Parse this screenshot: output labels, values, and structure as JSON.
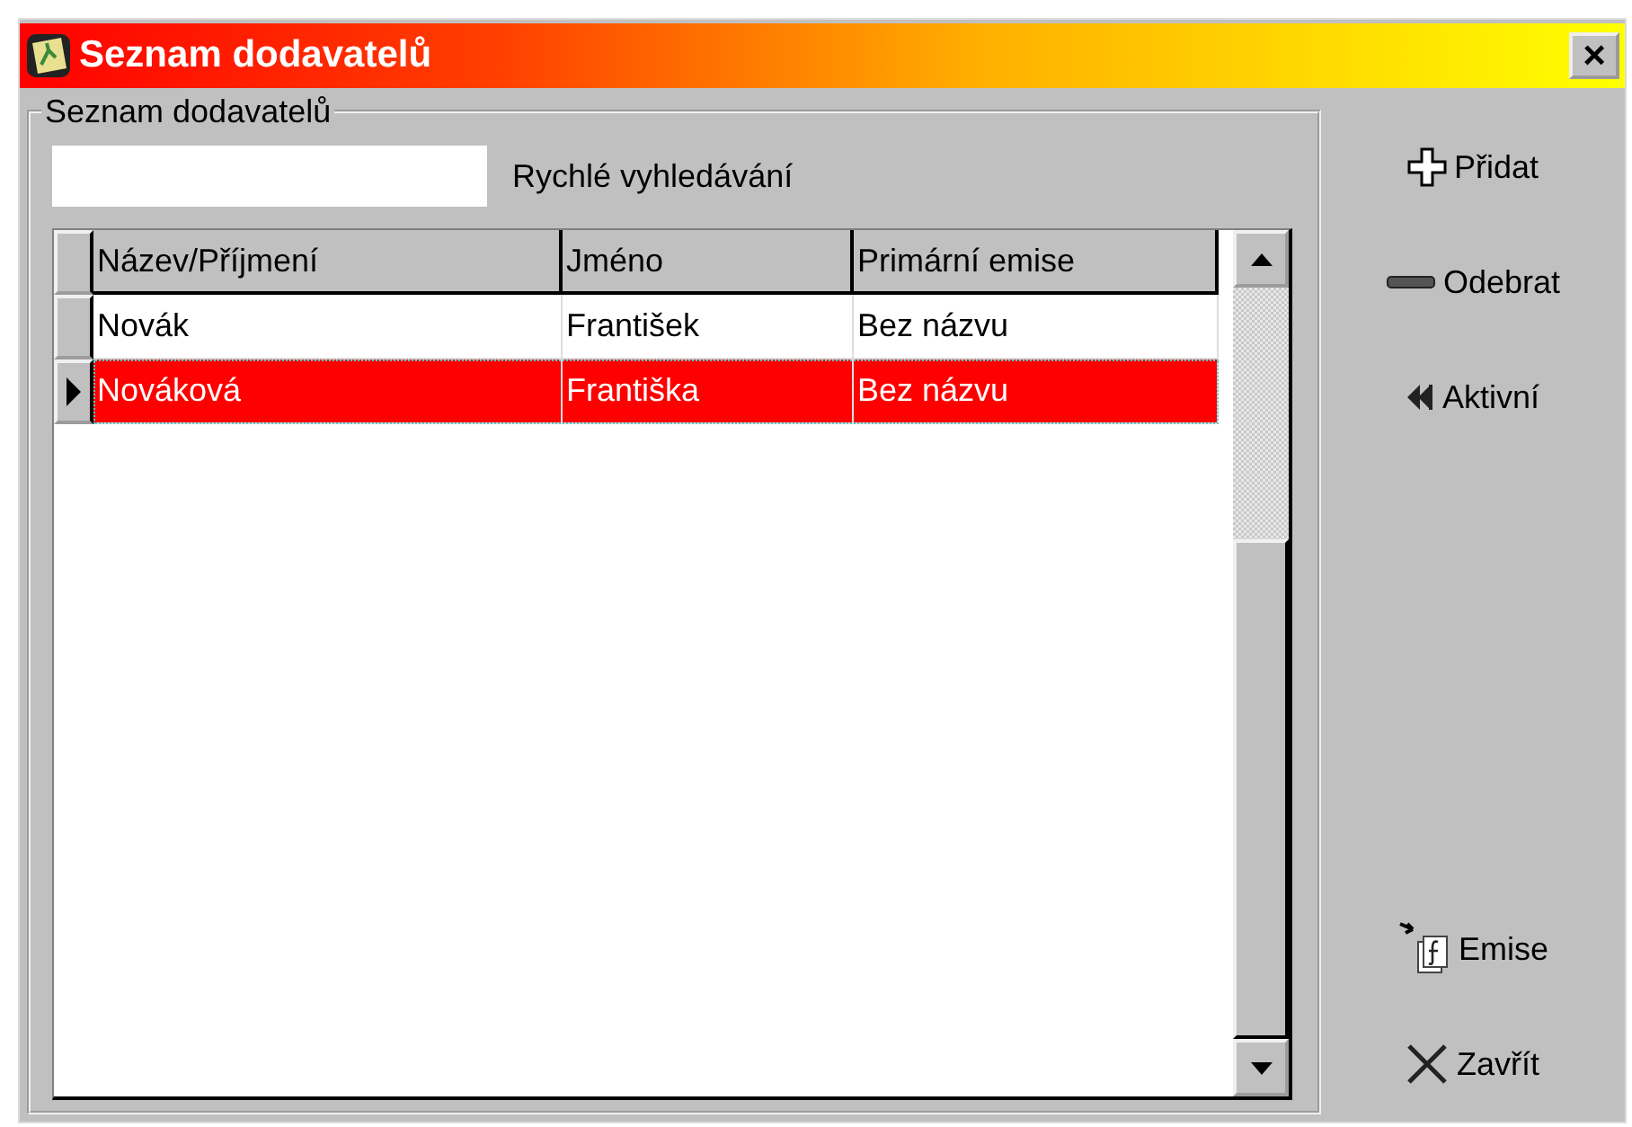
{
  "window": {
    "title": "Seznam dodavatelů",
    "close": "×"
  },
  "group": {
    "title": "Seznam dodavatelů"
  },
  "search": {
    "label": "Rychlé vyhledávání"
  },
  "table": {
    "columns": [
      "Název/Příjmení",
      "Jméno",
      "Primární emise"
    ],
    "rows": [
      {
        "cells": [
          "Novák",
          "František",
          "Bez názvu"
        ],
        "selected": false
      },
      {
        "cells": [
          "Nováková",
          "Františka",
          "Bez názvu"
        ],
        "selected": true
      }
    ]
  },
  "actions": [
    {
      "kind": "add",
      "label": "Přidat"
    },
    {
      "kind": "remove",
      "label": "Odebrat"
    },
    {
      "kind": "active",
      "label": "Aktivní"
    },
    {
      "kind": "emission",
      "label": "Emise"
    },
    {
      "kind": "close",
      "label": "Zavřít"
    }
  ]
}
